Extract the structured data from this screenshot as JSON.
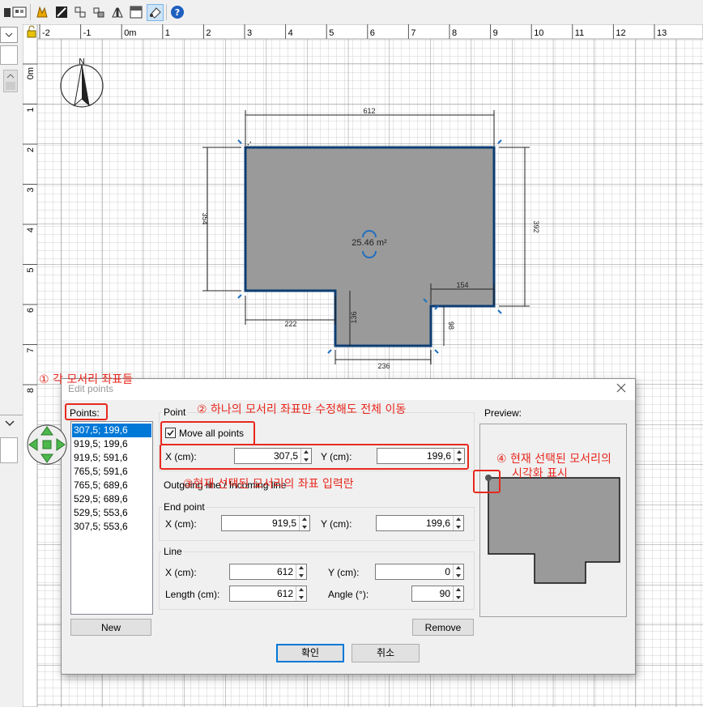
{
  "toolbar": {
    "icons": [
      "furniture-icon",
      "select-icon",
      "plan-icon",
      "room-icon",
      "polyline-icon",
      "dimension-icon",
      "wall-icon",
      "text-icon",
      "edit-points-icon",
      "help-icon"
    ]
  },
  "ruler": {
    "x_labels": [
      "-2",
      "-1",
      "0m",
      "1",
      "2",
      "3",
      "4",
      "5",
      "6",
      "7",
      "8",
      "9",
      "10",
      "11",
      "12",
      "13"
    ],
    "y_labels": [
      "0m",
      "1",
      "2",
      "3",
      "4",
      "5",
      "6",
      "7",
      "8"
    ]
  },
  "plan": {
    "compass_label": "N",
    "area_label": "25.46 m²",
    "dimensions": {
      "top": "612",
      "right": "392",
      "left": "354",
      "bottom_left": "222",
      "notch_height": "136",
      "right_lower": "98",
      "right_step": "154",
      "bottom": "236"
    }
  },
  "dialog": {
    "title": "Edit points",
    "points_label": "Points:",
    "points": [
      "307,5; 199,6",
      "919,5; 199,6",
      "919,5; 591,6",
      "765,5; 591,6",
      "765,5; 689,6",
      "529,5; 689,6",
      "529,5; 553,6",
      "307,5; 553,6"
    ],
    "selected_point_index": 0,
    "point_group_label": "Point",
    "move_all_label": "Move all points",
    "move_all_checked": true,
    "x_label": "X (cm):",
    "y_label": "Y (cm):",
    "point_x": "307,5",
    "point_y": "199,6",
    "outgoing_label": "Outgoing line / Incoming line",
    "end_group_label": "End point",
    "end_x": "919,5",
    "end_y": "199,6",
    "line_group_label": "Line",
    "line_x": "612",
    "line_y": "0",
    "length_label": "Length (cm):",
    "angle_label": "Angle (°):",
    "length": "612",
    "angle": "90",
    "preview_label": "Preview:",
    "new_button": "New",
    "remove_button": "Remove",
    "ok_button": "확인",
    "cancel_button": "취소"
  },
  "annotations": {
    "a1": "① 각 모서리 좌표들",
    "a2": "② 하나의 모서리 좌표만 수정해도 전체 이동",
    "a3": "③현재 선택된 모서리의 좌표 입력란",
    "a4_line1": "④ 현재 선택된 모서리의",
    "a4_line2": "시각화 표시"
  },
  "colors": {
    "annotation": "#e8281e",
    "room_fill": "#9a9a9a",
    "room_border": "#0d3d73",
    "selection": "#0078d7"
  }
}
